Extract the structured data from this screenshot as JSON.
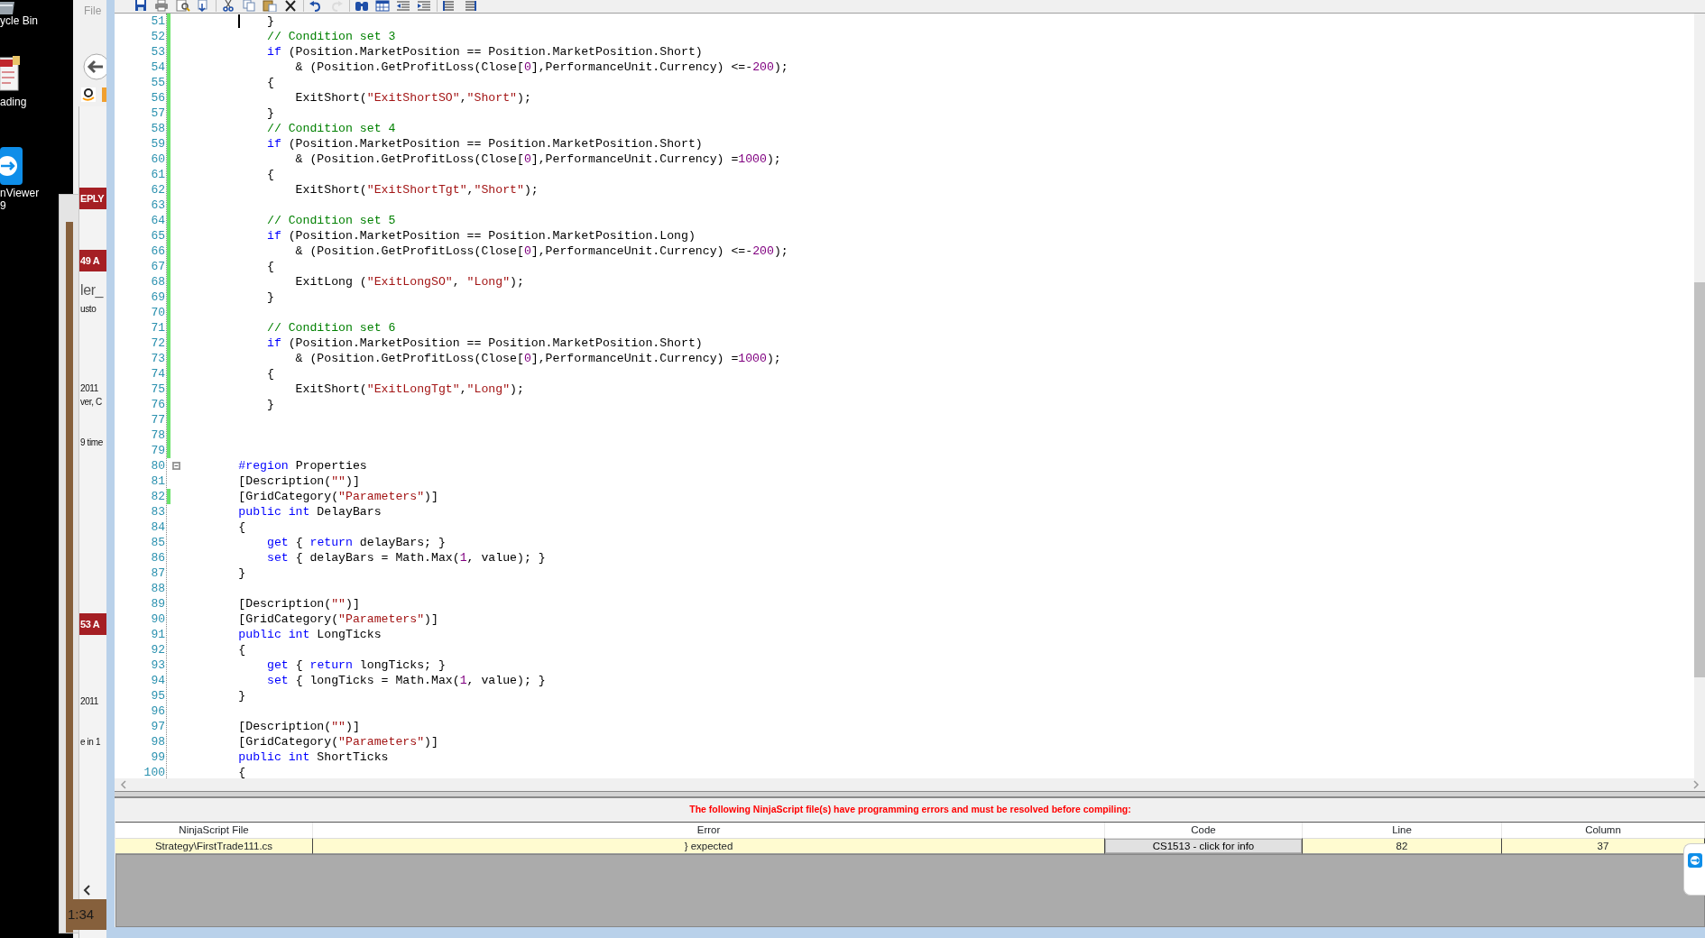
{
  "desktop_icons": [
    {
      "kind": "recycle-bin",
      "lines": [
        "ycle Bin"
      ]
    },
    {
      "kind": "document",
      "lines": [
        "ading"
      ]
    },
    {
      "kind": "remote",
      "lines": [
        "nViewer",
        "9"
      ]
    }
  ],
  "browser_window": {
    "menu": "File",
    "fragments": [
      {
        "kind": "banner",
        "text": "EPLY"
      },
      {
        "kind": "banner",
        "text": "49 A"
      },
      {
        "kind": "heading",
        "text": "ler_"
      },
      {
        "kind": "plain",
        "text": "usto"
      },
      {
        "kind": "plain",
        "text": "2011"
      },
      {
        "kind": "plain",
        "text": "ver, C"
      },
      {
        "kind": "plain",
        "text": "9 time"
      },
      {
        "kind": "banner",
        "text": "53 A"
      },
      {
        "kind": "plain",
        "text": "2011"
      },
      {
        "kind": "plain",
        "text": "e in 1"
      }
    ]
  },
  "side_window": {
    "clock": "1:34"
  },
  "toolbar": [
    [
      {
        "kind": "save",
        "disabled": false
      },
      {
        "kind": "print",
        "disabled": false
      },
      {
        "kind": "print-preview",
        "disabled": false
      },
      {
        "kind": "publish",
        "disabled": false
      }
    ],
    [
      {
        "kind": "cut",
        "disabled": false
      },
      {
        "kind": "copy",
        "disabled": false
      },
      {
        "kind": "paste",
        "disabled": false
      },
      {
        "kind": "delete",
        "disabled": false
      }
    ],
    [
      {
        "kind": "undo",
        "disabled": false
      },
      {
        "kind": "redo",
        "disabled": true
      }
    ],
    [
      {
        "kind": "find",
        "disabled": false
      },
      {
        "kind": "calendar",
        "disabled": false
      },
      {
        "kind": "outdent",
        "disabled": false
      },
      {
        "kind": "indent",
        "disabled": false
      }
    ],
    [
      {
        "kind": "comment",
        "disabled": false
      },
      {
        "kind": "uncomment",
        "disabled": false
      }
    ]
  ],
  "code_lines": [
    {
      "number": "51",
      "changed": true,
      "caret": true,
      "segments": [
        {
          "kind": "plain",
          "text": "            }"
        }
      ]
    },
    {
      "number": "52",
      "changed": true,
      "segments": [
        {
          "kind": "comment",
          "text": "            // Condition set 3"
        }
      ]
    },
    {
      "number": "53",
      "changed": true,
      "segments": [
        {
          "kind": "keyword",
          "text": "            if"
        },
        {
          "kind": "plain",
          "text": " (Position.MarketPosition == Position.MarketPosition.Short)"
        }
      ]
    },
    {
      "number": "54",
      "changed": true,
      "segments": [
        {
          "kind": "plain",
          "text": "                & (Position.GetProfitLoss(Close["
        },
        {
          "kind": "number",
          "text": "0"
        },
        {
          "kind": "plain",
          "text": "],PerformanceUnit.Currency) <=-"
        },
        {
          "kind": "number",
          "text": "200"
        },
        {
          "kind": "plain",
          "text": ");"
        }
      ]
    },
    {
      "number": "55",
      "changed": true,
      "segments": [
        {
          "kind": "plain",
          "text": "            {"
        }
      ]
    },
    {
      "number": "56",
      "changed": true,
      "segments": [
        {
          "kind": "plain",
          "text": "                ExitShort("
        },
        {
          "kind": "string",
          "text": "\"ExitShortSO\""
        },
        {
          "kind": "plain",
          "text": ","
        },
        {
          "kind": "string",
          "text": "\"Short\""
        },
        {
          "kind": "plain",
          "text": ");"
        }
      ]
    },
    {
      "number": "57",
      "changed": true,
      "segments": [
        {
          "kind": "plain",
          "text": "            }"
        }
      ]
    },
    {
      "number": "58",
      "changed": true,
      "segments": [
        {
          "kind": "comment",
          "text": "            // Condition set 4"
        }
      ]
    },
    {
      "number": "59",
      "changed": true,
      "segments": [
        {
          "kind": "keyword",
          "text": "            if"
        },
        {
          "kind": "plain",
          "text": " (Position.MarketPosition == Position.MarketPosition.Short)"
        }
      ]
    },
    {
      "number": "60",
      "changed": true,
      "segments": [
        {
          "kind": "plain",
          "text": "                & (Position.GetProfitLoss(Close["
        },
        {
          "kind": "number",
          "text": "0"
        },
        {
          "kind": "plain",
          "text": "],PerformanceUnit.Currency) ="
        },
        {
          "kind": "number",
          "text": "1000"
        },
        {
          "kind": "plain",
          "text": ");"
        }
      ]
    },
    {
      "number": "61",
      "changed": true,
      "segments": [
        {
          "kind": "plain",
          "text": "            {"
        }
      ]
    },
    {
      "number": "62",
      "changed": true,
      "segments": [
        {
          "kind": "plain",
          "text": "                ExitShort("
        },
        {
          "kind": "string",
          "text": "\"ExitShortTgt\""
        },
        {
          "kind": "plain",
          "text": ","
        },
        {
          "kind": "string",
          "text": "\"Short\""
        },
        {
          "kind": "plain",
          "text": ");"
        }
      ]
    },
    {
      "number": "63",
      "changed": true
    },
    {
      "number": "64",
      "changed": true,
      "segments": [
        {
          "kind": "comment",
          "text": "            // Condition set 5"
        }
      ]
    },
    {
      "number": "65",
      "changed": true,
      "segments": [
        {
          "kind": "keyword",
          "text": "            if"
        },
        {
          "kind": "plain",
          "text": " (Position.MarketPosition == Position.MarketPosition.Long)"
        }
      ]
    },
    {
      "number": "66",
      "changed": true,
      "segments": [
        {
          "kind": "plain",
          "text": "                & (Position.GetProfitLoss(Close["
        },
        {
          "kind": "number",
          "text": "0"
        },
        {
          "kind": "plain",
          "text": "],PerformanceUnit.Currency) <=-"
        },
        {
          "kind": "number",
          "text": "200"
        },
        {
          "kind": "plain",
          "text": ");"
        }
      ]
    },
    {
      "number": "67",
      "changed": true,
      "segments": [
        {
          "kind": "plain",
          "text": "            {"
        }
      ]
    },
    {
      "number": "68",
      "changed": true,
      "segments": [
        {
          "kind": "plain",
          "text": "                ExitLong ("
        },
        {
          "kind": "string",
          "text": "\"ExitLongSO\""
        },
        {
          "kind": "plain",
          "text": ", "
        },
        {
          "kind": "string",
          "text": "\"Long\""
        },
        {
          "kind": "plain",
          "text": ");"
        }
      ]
    },
    {
      "number": "69",
      "changed": true,
      "segments": [
        {
          "kind": "plain",
          "text": "            }"
        }
      ]
    },
    {
      "number": "70",
      "changed": true
    },
    {
      "number": "71",
      "changed": true,
      "segments": [
        {
          "kind": "comment",
          "text": "            // Condition set 6"
        }
      ]
    },
    {
      "number": "72",
      "changed": true,
      "segments": [
        {
          "kind": "keyword",
          "text": "            if"
        },
        {
          "kind": "plain",
          "text": " (Position.MarketPosition == Position.MarketPosition.Short)"
        }
      ]
    },
    {
      "number": "73",
      "changed": true,
      "segments": [
        {
          "kind": "plain",
          "text": "                & (Position.GetProfitLoss(Close["
        },
        {
          "kind": "number",
          "text": "0"
        },
        {
          "kind": "plain",
          "text": "],PerformanceUnit.Currency) ="
        },
        {
          "kind": "number",
          "text": "1000"
        },
        {
          "kind": "plain",
          "text": ");"
        }
      ]
    },
    {
      "number": "74",
      "changed": true,
      "segments": [
        {
          "kind": "plain",
          "text": "            {"
        }
      ]
    },
    {
      "number": "75",
      "changed": true,
      "segments": [
        {
          "kind": "plain",
          "text": "                ExitShort("
        },
        {
          "kind": "string",
          "text": "\"ExitLongTgt\""
        },
        {
          "kind": "plain",
          "text": ","
        },
        {
          "kind": "string",
          "text": "\"Long\""
        },
        {
          "kind": "plain",
          "text": ");"
        }
      ]
    },
    {
      "number": "76",
      "changed": true,
      "segments": [
        {
          "kind": "plain",
          "text": "            }"
        }
      ]
    },
    {
      "number": "77",
      "changed": true
    },
    {
      "number": "78",
      "changed": true
    },
    {
      "number": "79",
      "changed": true
    },
    {
      "number": "80",
      "changed": false,
      "fold_expanded": true,
      "segments": [
        {
          "kind": "keyword",
          "text": "        #region"
        },
        {
          "kind": "plain",
          "text": " Properties"
        }
      ]
    },
    {
      "number": "81",
      "changed": false,
      "segments": [
        {
          "kind": "plain",
          "text": "        [Description("
        },
        {
          "kind": "string",
          "text": "\"\""
        },
        {
          "kind": "plain",
          "text": ")]"
        }
      ]
    },
    {
      "number": "82",
      "changed": true,
      "segments": [
        {
          "kind": "plain",
          "text": "        [GridCategory("
        },
        {
          "kind": "string",
          "text": "\"Parameters\""
        },
        {
          "kind": "plain",
          "text": ")]"
        }
      ]
    },
    {
      "number": "83",
      "changed": false,
      "segments": [
        {
          "kind": "keyword",
          "text": "        public"
        },
        {
          "kind": "keyword",
          "text": " int"
        },
        {
          "kind": "plain",
          "text": " DelayBars"
        }
      ]
    },
    {
      "number": "84",
      "changed": false,
      "segments": [
        {
          "kind": "plain",
          "text": "        {"
        }
      ]
    },
    {
      "number": "85",
      "changed": false,
      "segments": [
        {
          "kind": "keyword",
          "text": "            get"
        },
        {
          "kind": "plain",
          "text": " { "
        },
        {
          "kind": "keyword",
          "text": "return"
        },
        {
          "kind": "plain",
          "text": " delayBars; }"
        }
      ]
    },
    {
      "number": "86",
      "changed": false,
      "segments": [
        {
          "kind": "keyword",
          "text": "            set"
        },
        {
          "kind": "plain",
          "text": " { delayBars = Math.Max("
        },
        {
          "kind": "number",
          "text": "1"
        },
        {
          "kind": "plain",
          "text": ", value); }"
        }
      ]
    },
    {
      "number": "87",
      "changed": false,
      "segments": [
        {
          "kind": "plain",
          "text": "        }"
        }
      ]
    },
    {
      "number": "88",
      "changed": false
    },
    {
      "number": "89",
      "changed": false,
      "segments": [
        {
          "kind": "plain",
          "text": "        [Description("
        },
        {
          "kind": "string",
          "text": "\"\""
        },
        {
          "kind": "plain",
          "text": ")]"
        }
      ]
    },
    {
      "number": "90",
      "changed": false,
      "segments": [
        {
          "kind": "plain",
          "text": "        [GridCategory("
        },
        {
          "kind": "string",
          "text": "\"Parameters\""
        },
        {
          "kind": "plain",
          "text": ")]"
        }
      ]
    },
    {
      "number": "91",
      "changed": false,
      "segments": [
        {
          "kind": "keyword",
          "text": "        public"
        },
        {
          "kind": "keyword",
          "text": " int"
        },
        {
          "kind": "plain",
          "text": " LongTicks"
        }
      ]
    },
    {
      "number": "92",
      "changed": false,
      "segments": [
        {
          "kind": "plain",
          "text": "        {"
        }
      ]
    },
    {
      "number": "93",
      "changed": false,
      "segments": [
        {
          "kind": "keyword",
          "text": "            get"
        },
        {
          "kind": "plain",
          "text": " { "
        },
        {
          "kind": "keyword",
          "text": "return"
        },
        {
          "kind": "plain",
          "text": " longTicks; }"
        }
      ]
    },
    {
      "number": "94",
      "changed": false,
      "segments": [
        {
          "kind": "keyword",
          "text": "            set"
        },
        {
          "kind": "plain",
          "text": " { longTicks = Math.Max("
        },
        {
          "kind": "number",
          "text": "1"
        },
        {
          "kind": "plain",
          "text": ", value); }"
        }
      ]
    },
    {
      "number": "95",
      "changed": false,
      "segments": [
        {
          "kind": "plain",
          "text": "        }"
        }
      ]
    },
    {
      "number": "96",
      "changed": false
    },
    {
      "number": "97",
      "changed": false,
      "segments": [
        {
          "kind": "plain",
          "text": "        [Description("
        },
        {
          "kind": "string",
          "text": "\"\""
        },
        {
          "kind": "plain",
          "text": ")]"
        }
      ]
    },
    {
      "number": "98",
      "changed": false,
      "segments": [
        {
          "kind": "plain",
          "text": "        [GridCategory("
        },
        {
          "kind": "string",
          "text": "\"Parameters\""
        },
        {
          "kind": "plain",
          "text": ")]"
        }
      ]
    },
    {
      "number": "99",
      "changed": false,
      "segments": [
        {
          "kind": "keyword",
          "text": "        public"
        },
        {
          "kind": "keyword",
          "text": " int"
        },
        {
          "kind": "plain",
          "text": " ShortTicks"
        }
      ]
    },
    {
      "number": "100",
      "changed": false,
      "segments": [
        {
          "kind": "plain",
          "text": "        {"
        }
      ]
    }
  ],
  "error_panel": {
    "message": "The following NinjaScript file(s) have programming errors and must be resolved before compiling:",
    "columns": [
      {
        "label": "NinjaScript File",
        "kind": "text"
      },
      {
        "label": "Error",
        "kind": "text"
      },
      {
        "label": "Code",
        "kind": "button"
      },
      {
        "label": "Line",
        "kind": "text"
      },
      {
        "label": "Column",
        "kind": "text"
      }
    ],
    "rows": [
      {
        "cells": [
          "Strategy\\FirstTrade111.cs",
          "} expected",
          "CS1513 - click for info",
          "82",
          "37"
        ]
      }
    ]
  }
}
